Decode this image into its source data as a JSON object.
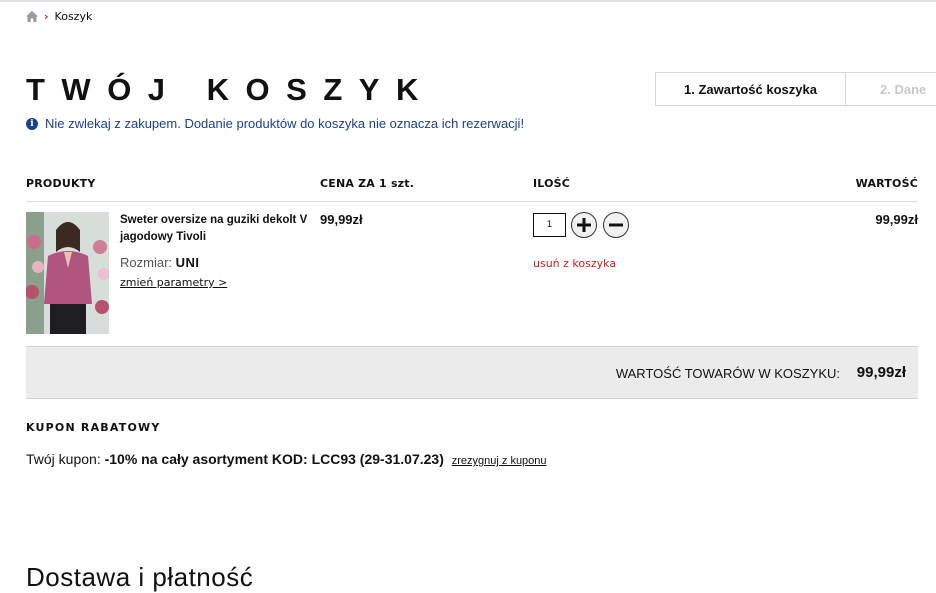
{
  "breadcrumb": {
    "home_icon": "home-icon",
    "current": "Koszyk"
  },
  "page_title": "TWÓJ KOSZYK",
  "steps": [
    {
      "label": "1. Zawartość koszyka",
      "active": true
    },
    {
      "label": "2. Dane",
      "active": false
    }
  ],
  "notice": {
    "icon": "info-icon",
    "text": "Nie zwlekaj z zakupem. Dodanie produktów do koszyka nie oznacza ich rezerwacji!"
  },
  "table": {
    "headers": {
      "products": "PRODUKTY",
      "unit_price": "CENA ZA 1 szt.",
      "quantity": "ILOŚĆ",
      "value": "WARTOŚĆ"
    }
  },
  "item": {
    "name": "Sweter oversize na guziki dekolt V jagodowy Tivoli",
    "size_label": "Rozmiar:",
    "size_value": "UNI",
    "change_params": "zmień parametry >",
    "unit_price": "99,99zł",
    "quantity": "1",
    "remove": "usuń z koszyka",
    "total": "99,99zł"
  },
  "summary": {
    "label": "WARTOŚĆ TOWARÓW W KOSZYKU:",
    "value": "99,99zł"
  },
  "coupon": {
    "title": "KUPON RABATOWY",
    "prefix": "Twój kupon:",
    "code": "-10% na cały asortyment KOD: LCC93 (29-31.07.23)",
    "cancel": "zrezygnuj z kuponu"
  },
  "delivery_heading": "Dostawa i płatność",
  "colors": {
    "accent_red": "#d8202a",
    "notice_blue": "#1c3f8f",
    "remove_red": "#d11a1a"
  }
}
